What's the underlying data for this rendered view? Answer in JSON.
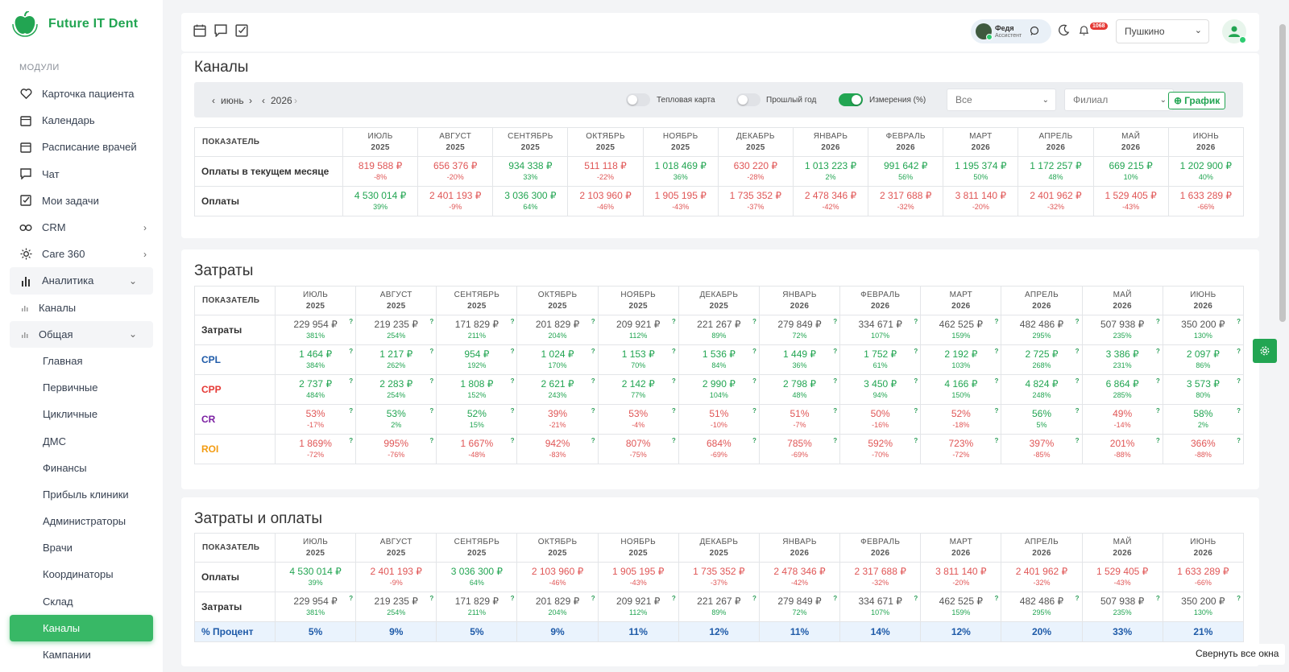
{
  "brand": {
    "name": "Future IT Dent",
    "color": "#22a552"
  },
  "sidebar": {
    "section": "МОДУЛИ",
    "items": [
      {
        "label": "Карточка пациента",
        "icon": "heart-icon"
      },
      {
        "label": "Календарь",
        "icon": "calendar-icon"
      },
      {
        "label": "Расписание врачей",
        "icon": "calendar-icon"
      },
      {
        "label": "Чат",
        "icon": "chat-icon"
      },
      {
        "label": "Мои задачи",
        "icon": "checkbox-icon"
      },
      {
        "label": "CRM",
        "icon": "infinity-icon"
      },
      {
        "label": "Care 360",
        "icon": "sun-icon"
      },
      {
        "label": "Аналитика",
        "icon": "bar-chart-icon"
      },
      {
        "label": "Каналы",
        "icon": "small-bar-icon"
      },
      {
        "label": "Общая",
        "icon": "small-bar-icon"
      },
      {
        "label": "Главная"
      },
      {
        "label": "Первичные"
      },
      {
        "label": "Цикличные"
      },
      {
        "label": "ДМС"
      },
      {
        "label": "Финансы"
      },
      {
        "label": "Прибыль клиники"
      },
      {
        "label": "Администраторы"
      },
      {
        "label": "Врачи"
      },
      {
        "label": "Координаторы"
      },
      {
        "label": "Склад"
      },
      {
        "label": "Каналы"
      },
      {
        "label": "Кампании"
      }
    ]
  },
  "topbar": {
    "assistant_name": "Федя",
    "assistant_role": "Ассистент",
    "notifications": "1068",
    "branch": "Пушкино"
  },
  "channels": {
    "title": "Каналы",
    "month": "июнь",
    "year": "2026",
    "heatmap_label": "Тепловая карта",
    "prev_year_label": "Прошлый год",
    "measures_label": "Измерения (%)",
    "filter_all": "Все",
    "filter_branch": "Филиал",
    "graph_btn": "График"
  },
  "header_label": "ПОКАЗАТЕЛЬ",
  "months": [
    {
      "m": "ИЮЛЬ",
      "y": "2025"
    },
    {
      "m": "АВГУСТ",
      "y": "2025"
    },
    {
      "m": "СЕНТЯБРЬ",
      "y": "2025"
    },
    {
      "m": "ОКТЯБРЬ",
      "y": "2025"
    },
    {
      "m": "НОЯБРЬ",
      "y": "2025"
    },
    {
      "m": "ДЕКАБРЬ",
      "y": "2025"
    },
    {
      "m": "ЯНВАРЬ",
      "y": "2026"
    },
    {
      "m": "ФЕВРАЛЬ",
      "y": "2026"
    },
    {
      "m": "МАРТ",
      "y": "2026"
    },
    {
      "m": "АПРЕЛЬ",
      "y": "2026"
    },
    {
      "m": "МАЙ",
      "y": "2026"
    },
    {
      "m": "ИЮНЬ",
      "y": "2026"
    }
  ],
  "table1": {
    "rows": [
      {
        "label": "Оплаты в текущем месяце",
        "values": [
          "819 588 ₽",
          "656 376 ₽",
          "934 338 ₽",
          "511 118 ₽",
          "1 018 469 ₽",
          "630 220 ₽",
          "1 013 223 ₽",
          "991 642 ₽",
          "1 195 374 ₽",
          "1 172 257 ₽",
          "669 215 ₽",
          "1 202 900 ₽"
        ],
        "pcts": [
          "-8%",
          "-20%",
          "33%",
          "-22%",
          "36%",
          "-28%",
          "2%",
          "56%",
          "50%",
          "48%",
          "10%",
          "40%"
        ]
      },
      {
        "label": "Оплаты",
        "values": [
          "4 530 014 ₽",
          "2 401 193 ₽",
          "3 036 300 ₽",
          "2 103 960 ₽",
          "1 905 195 ₽",
          "1 735 352 ₽",
          "2 478 346 ₽",
          "2 317 688 ₽",
          "3 811 140 ₽",
          "2 401 962 ₽",
          "1 529 405 ₽",
          "1 633 289 ₽"
        ],
        "pcts": [
          "39%",
          "-9%",
          "64%",
          "-46%",
          "-43%",
          "-37%",
          "-42%",
          "-32%",
          "-20%",
          "-32%",
          "-43%",
          "-66%"
        ]
      }
    ]
  },
  "costs": {
    "title": "Затраты",
    "rows": [
      {
        "label": "Затраты",
        "color": "#333333",
        "values": [
          "229 954 ₽",
          "219 235 ₽",
          "171 829 ₽",
          "201 829 ₽",
          "209 921 ₽",
          "221 267 ₽",
          "279 849 ₽",
          "334 671 ₽",
          "462 525 ₽",
          "482 486 ₽",
          "507 938 ₽",
          "350 200 ₽"
        ],
        "pcts": [
          "381%",
          "254%",
          "211%",
          "204%",
          "112%",
          "89%",
          "72%",
          "107%",
          "159%",
          "295%",
          "235%",
          "130%"
        ]
      },
      {
        "label": "CPL",
        "color": "#1e5aa8",
        "values": [
          "1 464 ₽",
          "1 217 ₽",
          "954 ₽",
          "1 024 ₽",
          "1 153 ₽",
          "1 536 ₽",
          "1 449 ₽",
          "1 752 ₽",
          "2 192 ₽",
          "2 725 ₽",
          "3 386 ₽",
          "2 097 ₽"
        ],
        "pcts": [
          "384%",
          "262%",
          "192%",
          "170%",
          "70%",
          "84%",
          "36%",
          "61%",
          "103%",
          "268%",
          "231%",
          "86%"
        ]
      },
      {
        "label": "CPP",
        "color": "#e53935",
        "values": [
          "2 737 ₽",
          "2 283 ₽",
          "1 808 ₽",
          "2 621 ₽",
          "2 142 ₽",
          "2 990 ₽",
          "2 798 ₽",
          "3 450 ₽",
          "4 166 ₽",
          "4 824 ₽",
          "6 864 ₽",
          "3 573 ₽"
        ],
        "pcts": [
          "484%",
          "254%",
          "152%",
          "243%",
          "77%",
          "104%",
          "48%",
          "94%",
          "150%",
          "248%",
          "285%",
          "80%"
        ]
      },
      {
        "label": "CR",
        "color": "#7b1fa2",
        "values": [
          "53%",
          "53%",
          "52%",
          "39%",
          "53%",
          "51%",
          "51%",
          "50%",
          "52%",
          "56%",
          "49%",
          "58%"
        ],
        "pcts": [
          "-17%",
          "2%",
          "15%",
          "-21%",
          "-4%",
          "-10%",
          "-7%",
          "-16%",
          "-18%",
          "5%",
          "-14%",
          "2%"
        ]
      },
      {
        "label": "ROI",
        "color": "#f39c12",
        "values": [
          "1 869%",
          "995%",
          "1 667%",
          "942%",
          "807%",
          "684%",
          "785%",
          "592%",
          "723%",
          "397%",
          "201%",
          "366%"
        ],
        "pcts": [
          "-72%",
          "-76%",
          "-48%",
          "-83%",
          "-75%",
          "-69%",
          "-69%",
          "-70%",
          "-72%",
          "-85%",
          "-88%",
          "-88%"
        ]
      }
    ]
  },
  "costs_payments": {
    "title": "Затраты и оплаты",
    "payments": {
      "label": "Оплаты",
      "values": [
        "4 530 014 ₽",
        "2 401 193 ₽",
        "3 036 300 ₽",
        "2 103 960 ₽",
        "1 905 195 ₽",
        "1 735 352 ₽",
        "2 478 346 ₽",
        "2 317 688 ₽",
        "3 811 140 ₽",
        "2 401 962 ₽",
        "1 529 405 ₽",
        "1 633 289 ₽"
      ],
      "pcts": [
        "39%",
        "-9%",
        "64%",
        "-46%",
        "-43%",
        "-37%",
        "-42%",
        "-32%",
        "-20%",
        "-32%",
        "-43%",
        "-66%"
      ]
    },
    "costs": {
      "label": "Затраты",
      "values": [
        "229 954 ₽",
        "219 235 ₽",
        "171 829 ₽",
        "201 829 ₽",
        "209 921 ₽",
        "221 267 ₽",
        "279 849 ₽",
        "334 671 ₽",
        "462 525 ₽",
        "482 486 ₽",
        "507 938 ₽",
        "350 200 ₽"
      ],
      "pcts": [
        "381%",
        "254%",
        "211%",
        "204%",
        "112%",
        "89%",
        "72%",
        "107%",
        "159%",
        "295%",
        "235%",
        "130%"
      ]
    },
    "percent": {
      "label": "% Процент",
      "values": [
        "5%",
        "9%",
        "5%",
        "9%",
        "11%",
        "12%",
        "11%",
        "14%",
        "12%",
        "20%",
        "33%",
        "21%"
      ]
    }
  },
  "collapse_label": "Свернуть все окна"
}
